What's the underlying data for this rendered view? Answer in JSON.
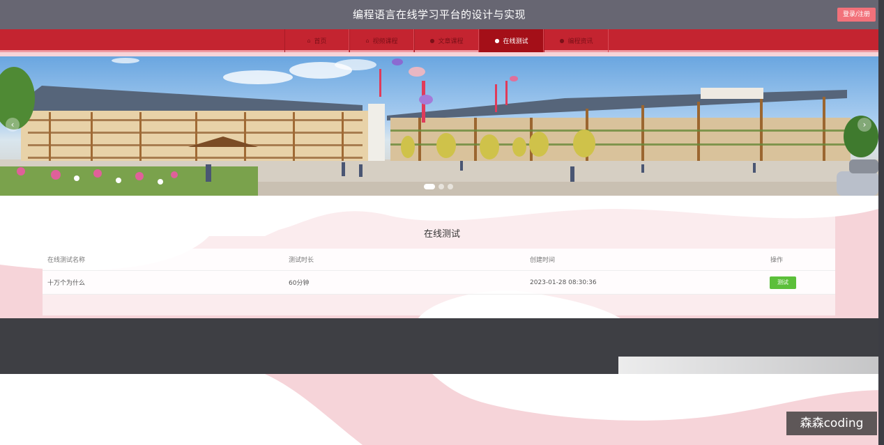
{
  "header": {
    "title": "编程语言在线学习平台的设计与实现",
    "login_label": "登录/注册"
  },
  "nav": {
    "items": [
      {
        "label": "首页",
        "icon": "home-icon",
        "glyph": "⌂"
      },
      {
        "label": "视频课程",
        "icon": "lock-icon",
        "glyph": "⌂"
      },
      {
        "label": "文章课程",
        "icon": "info-circle-icon",
        "glyph": "●"
      },
      {
        "label": "在线测试",
        "icon": "info-circle-icon",
        "glyph": "●"
      },
      {
        "label": "编程资讯",
        "icon": "info-circle-icon",
        "glyph": "●"
      }
    ],
    "active_index": 3
  },
  "banner": {
    "arrow_prev": "‹",
    "arrow_next": "›",
    "slides": 3,
    "active_slide": 0
  },
  "section": {
    "title": "在线测试"
  },
  "table": {
    "headers": [
      "在线测试名称",
      "测试时长",
      "创建时间",
      "操作"
    ],
    "rows": [
      {
        "name": "十万个为什么",
        "duration": "60分钟",
        "created": "2023-01-28 08:30:36",
        "action": "测试"
      }
    ]
  },
  "watermark": "森森coding",
  "colors": {
    "header_bg": "#676672",
    "nav_bg": "#c42430",
    "nav_active": "#a40f18",
    "login_btn": "#f2717a",
    "test_btn": "#5cbf3a",
    "footer_bg": "#3e3f44",
    "page_bg": "#f6d4d9"
  }
}
